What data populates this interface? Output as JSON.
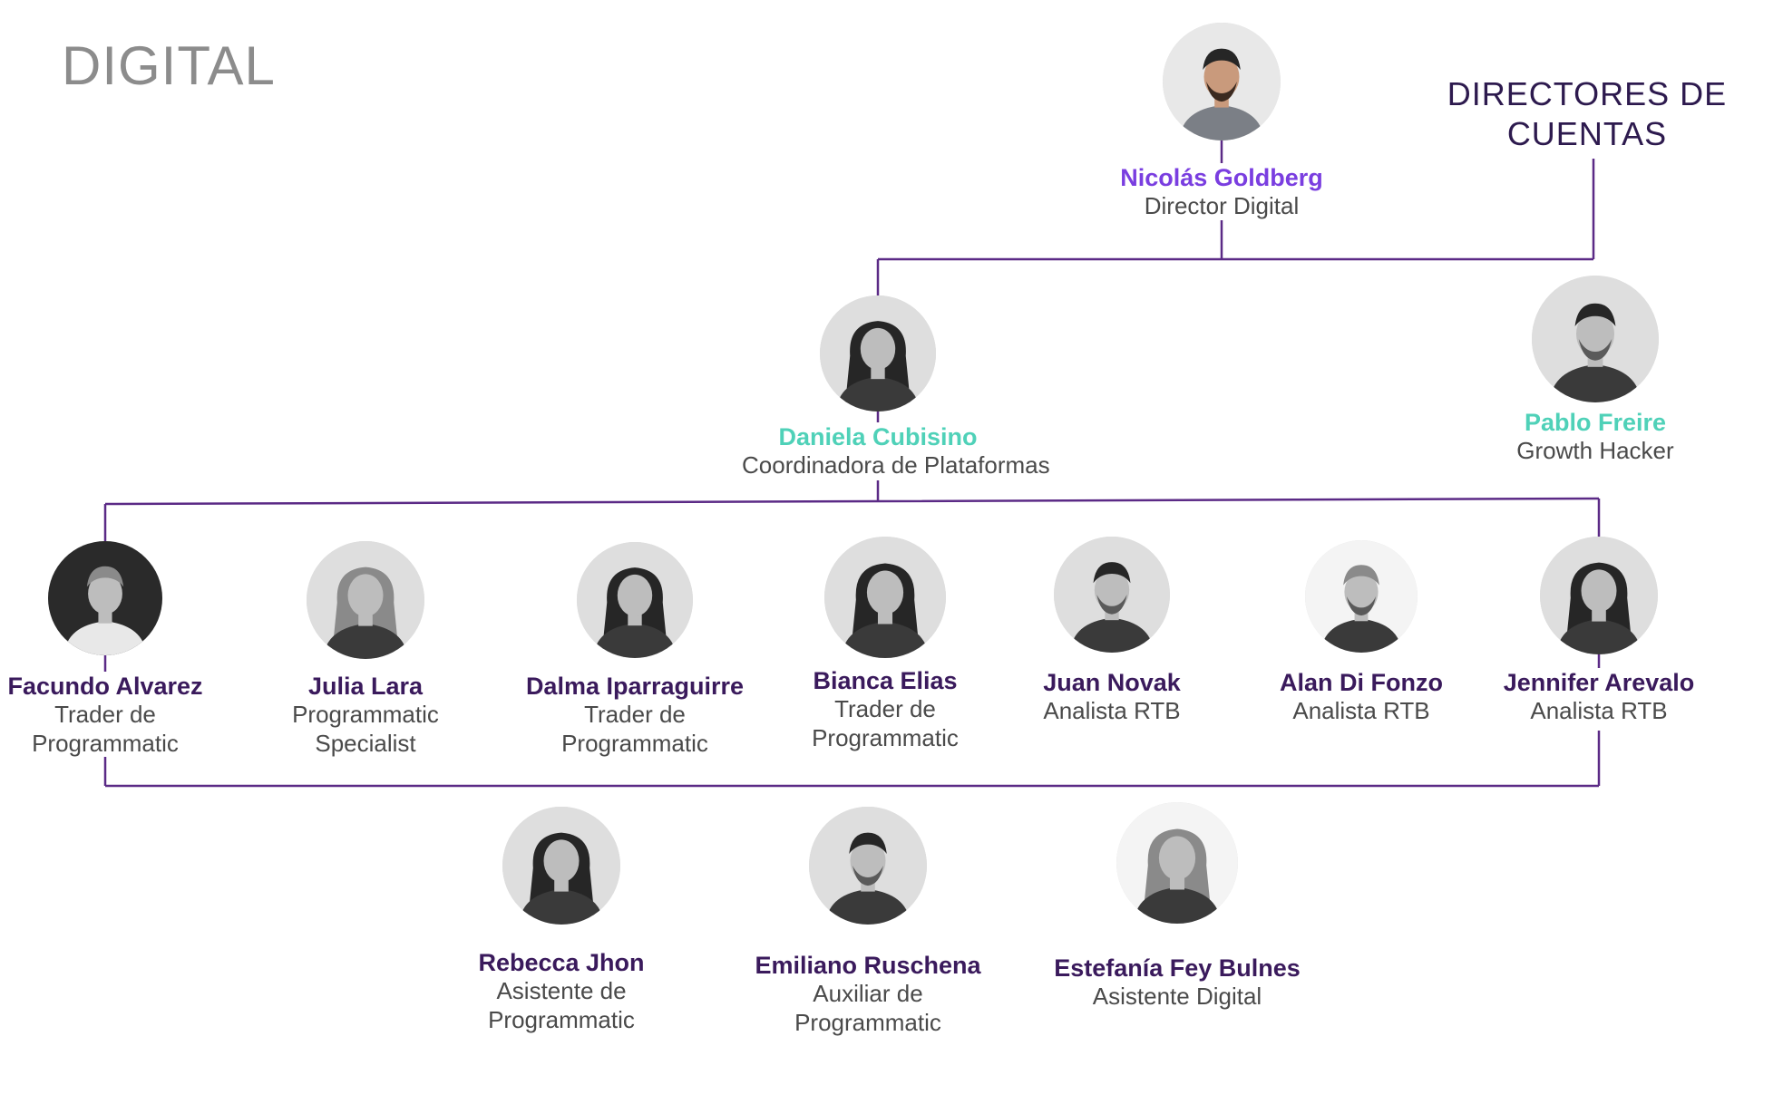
{
  "title": "DIGITAL",
  "directors_label": [
    "DIRECTORES DE",
    "CUENTAS"
  ],
  "colors": {
    "line": "#5b2a86",
    "name_default": "#3a1a5c",
    "name_director": "#7a3ee0",
    "name_teal": "#4fd1b8",
    "role": "#4a4a4a",
    "title": "#8c8c8c"
  },
  "people": [
    {
      "id": "nicolas-goldberg",
      "name": "Nicolás Goldberg",
      "role": [
        "Director Digital"
      ],
      "name_color": "#7a3ee0",
      "photo": "color",
      "hair": "short-dark",
      "beard": true
    },
    {
      "id": "daniela-cubisino",
      "name": "Daniela Cubisino",
      "role": [
        "Coordinadora de Plataformas"
      ],
      "name_color": "#4fd1b8",
      "photo": "bw",
      "hair": "long-dark",
      "beard": false
    },
    {
      "id": "pablo-freire",
      "name": "Pablo Freire",
      "role": [
        "Growth Hacker"
      ],
      "name_color": "#4fd1b8",
      "photo": "bw",
      "hair": "short-dark",
      "beard": true
    },
    {
      "id": "facundo-alvarez",
      "name": "Facundo Alvarez",
      "role": [
        "Trader de",
        "Programmatic"
      ],
      "name_color": "#3a1a5c",
      "photo": "bw-dark",
      "hair": "short-light",
      "beard": false
    },
    {
      "id": "julia-lara",
      "name": "Julia Lara",
      "role": [
        "Programmatic",
        "Specialist"
      ],
      "name_color": "#3a1a5c",
      "photo": "bw",
      "hair": "long-light",
      "beard": false
    },
    {
      "id": "dalma-iparraguirre",
      "name": "Dalma Iparraguirre",
      "role": [
        "Trader de",
        "Programmatic"
      ],
      "name_color": "#3a1a5c",
      "photo": "bw",
      "hair": "long-dark",
      "beard": false
    },
    {
      "id": "bianca-elias",
      "name": "Bianca Elias",
      "role": [
        "Trader de",
        "Programmatic"
      ],
      "name_color": "#3a1a5c",
      "photo": "bw",
      "hair": "long-dark",
      "beard": false
    },
    {
      "id": "juan-novak",
      "name": "Juan Novak",
      "role": [
        "Analista RTB"
      ],
      "name_color": "#3a1a5c",
      "photo": "bw",
      "hair": "short-dark",
      "beard": true
    },
    {
      "id": "alan-di-fonzo",
      "name": "Alan Di Fonzo",
      "role": [
        "Analista RTB"
      ],
      "name_color": "#3a1a5c",
      "photo": "bw-white",
      "hair": "short-light",
      "beard": true
    },
    {
      "id": "jennifer-arevalo",
      "name": "Jennifer Arevalo",
      "role": [
        "Analista RTB"
      ],
      "name_color": "#3a1a5c",
      "photo": "bw",
      "hair": "long-dark",
      "beard": false
    },
    {
      "id": "rebecca-jhon",
      "name": "Rebecca Jhon",
      "role": [
        "Asistente de",
        "Programmatic"
      ],
      "name_color": "#3a1a5c",
      "photo": "bw",
      "hair": "long-dark",
      "beard": false
    },
    {
      "id": "emiliano-ruschena",
      "name": "Emiliano Ruschena",
      "role": [
        "Auxiliar de",
        "Programmatic"
      ],
      "name_color": "#3a1a5c",
      "photo": "bw",
      "hair": "short-dark",
      "beard": true
    },
    {
      "id": "estefania-fey-bulnes",
      "name": "Estefanía Fey Bulnes",
      "role": [
        "Asistente Digital"
      ],
      "name_color": "#3a1a5c",
      "photo": "bw-white",
      "hair": "long-light",
      "beard": false
    }
  ]
}
